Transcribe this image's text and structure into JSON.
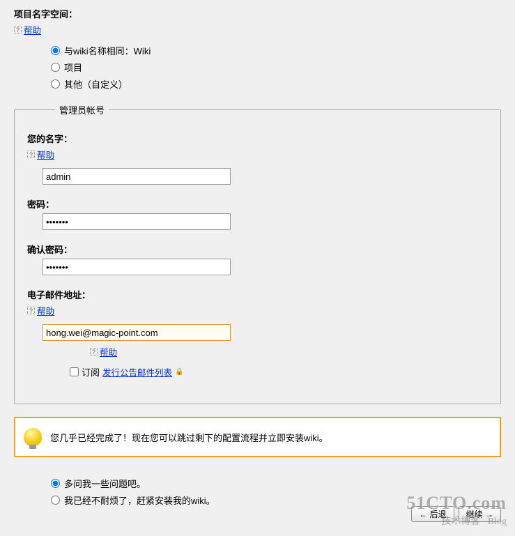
{
  "namespace": {
    "label": "项目名字空间：",
    "help": "帮助",
    "options": {
      "same_as_wiki": "与wiki名称相同：Wiki",
      "project": "项目",
      "other": "其他（自定义）"
    },
    "selected": "same_as_wiki"
  },
  "admin": {
    "legend": "管理员帐号",
    "name": {
      "label": "您的名字：",
      "help": "帮助",
      "value": "admin"
    },
    "password": {
      "label": "密码：",
      "value": "•••••••"
    },
    "confirm_password": {
      "label": "确认密码：",
      "value": "•••••••"
    },
    "email": {
      "label": "电子邮件地址：",
      "help": "帮助",
      "value": "hong.wei@magic-point.com",
      "sub_help": "帮助",
      "subscribe_label": "订阅",
      "subscribe_link": "发行公告邮件列表"
    }
  },
  "info": {
    "message": "您几乎已经完成了！现在您可以跳过剩下的配置流程并立即安装wiki。"
  },
  "questions": {
    "ask_more": "多问我一些问题吧。",
    "install_now": "我已经不耐烦了，赶紧安装我的wiki。",
    "selected": "ask_more"
  },
  "buttons": {
    "back": "← 后退",
    "continue": "继续 →"
  },
  "watermark": {
    "line1": "51CTO.com",
    "line2": "技术博客",
    "line3": "Blog"
  }
}
